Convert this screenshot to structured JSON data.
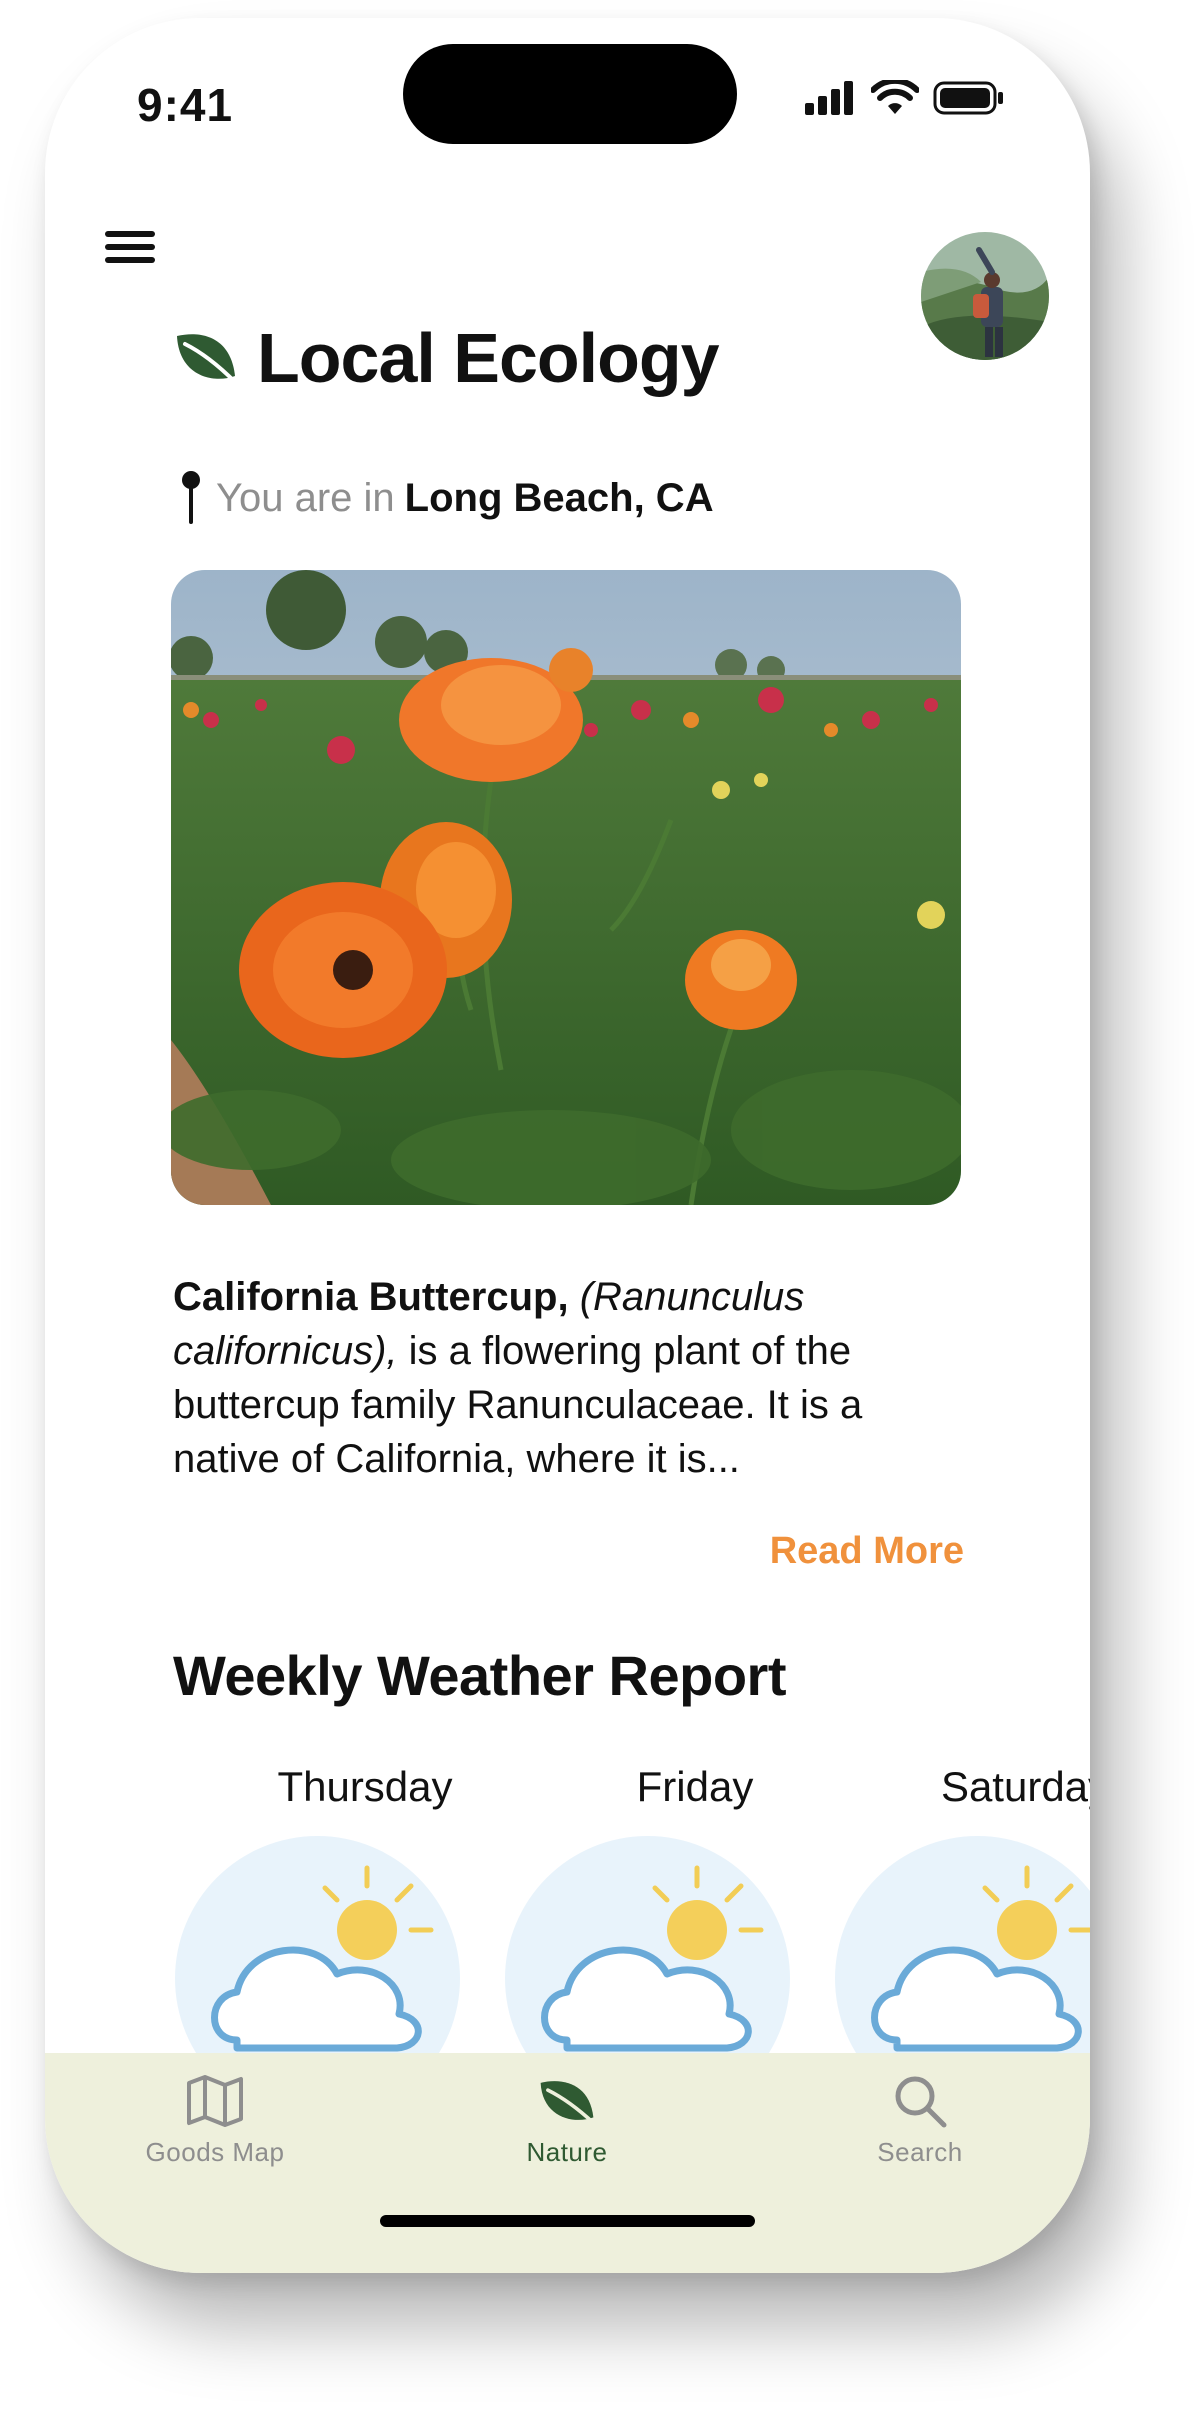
{
  "status_bar": {
    "time": "9:41"
  },
  "header": {
    "title": "Local Ecology",
    "location_prefix": "You are in",
    "location_place": "Long Beach, CA"
  },
  "featured": {
    "name": "California Buttercup,",
    "scientific_name": "(Ranunculus californicus),",
    "description": "is a flowering plant of the buttercup family Ranunculaceae. It is a native of California, where it is...",
    "read_more_label": "Read More"
  },
  "weather": {
    "title": "Weekly Weather Report",
    "days": [
      {
        "label": "Thursday",
        "icon": "partly-cloudy-icon"
      },
      {
        "label": "Friday",
        "icon": "partly-cloudy-icon"
      },
      {
        "label": "Saturday",
        "icon": "partly-cloudy-icon"
      }
    ]
  },
  "tab_bar": {
    "tabs": [
      {
        "label": "Goods Map",
        "icon": "map-icon",
        "active": false
      },
      {
        "label": "Nature",
        "icon": "leaf-icon",
        "active": true
      },
      {
        "label": "Search",
        "icon": "search-icon",
        "active": false
      }
    ]
  },
  "colors": {
    "accent": "#f0913c",
    "leaf_green": "#2f5a32",
    "tab_bar_bg": "#eef0dc",
    "inactive_tab": "#8e8e8e",
    "weather_circle": "#e8f3fb",
    "cloud_stroke": "#6aaad8",
    "sun": "#f4cf5a"
  }
}
